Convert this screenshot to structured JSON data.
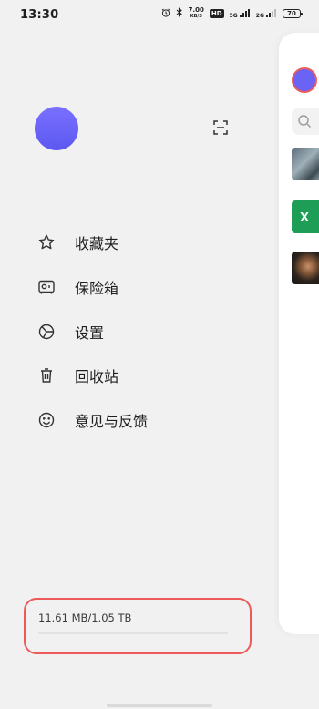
{
  "status_bar": {
    "time": "13:30",
    "speed_value": "7.00",
    "speed_unit": "KB/S",
    "hd_label": "HD",
    "net1": "5G",
    "net2": "2G",
    "battery": "70"
  },
  "menu": {
    "items": [
      {
        "label": "收藏夹",
        "icon": "star-icon"
      },
      {
        "label": "保险箱",
        "icon": "safe-icon"
      },
      {
        "label": "设置",
        "icon": "settings-icon"
      },
      {
        "label": "回收站",
        "icon": "trash-icon"
      },
      {
        "label": "意见与反馈",
        "icon": "smile-icon"
      }
    ]
  },
  "storage": {
    "text": "11.61 MB/1.05 TB",
    "used_fraction": 1e-05
  },
  "peek": {
    "thumb2_letter": "X"
  },
  "colors": {
    "avatar": "#6a63f5",
    "highlight": "#ee5a5a",
    "excel_green": "#1e9d57"
  }
}
